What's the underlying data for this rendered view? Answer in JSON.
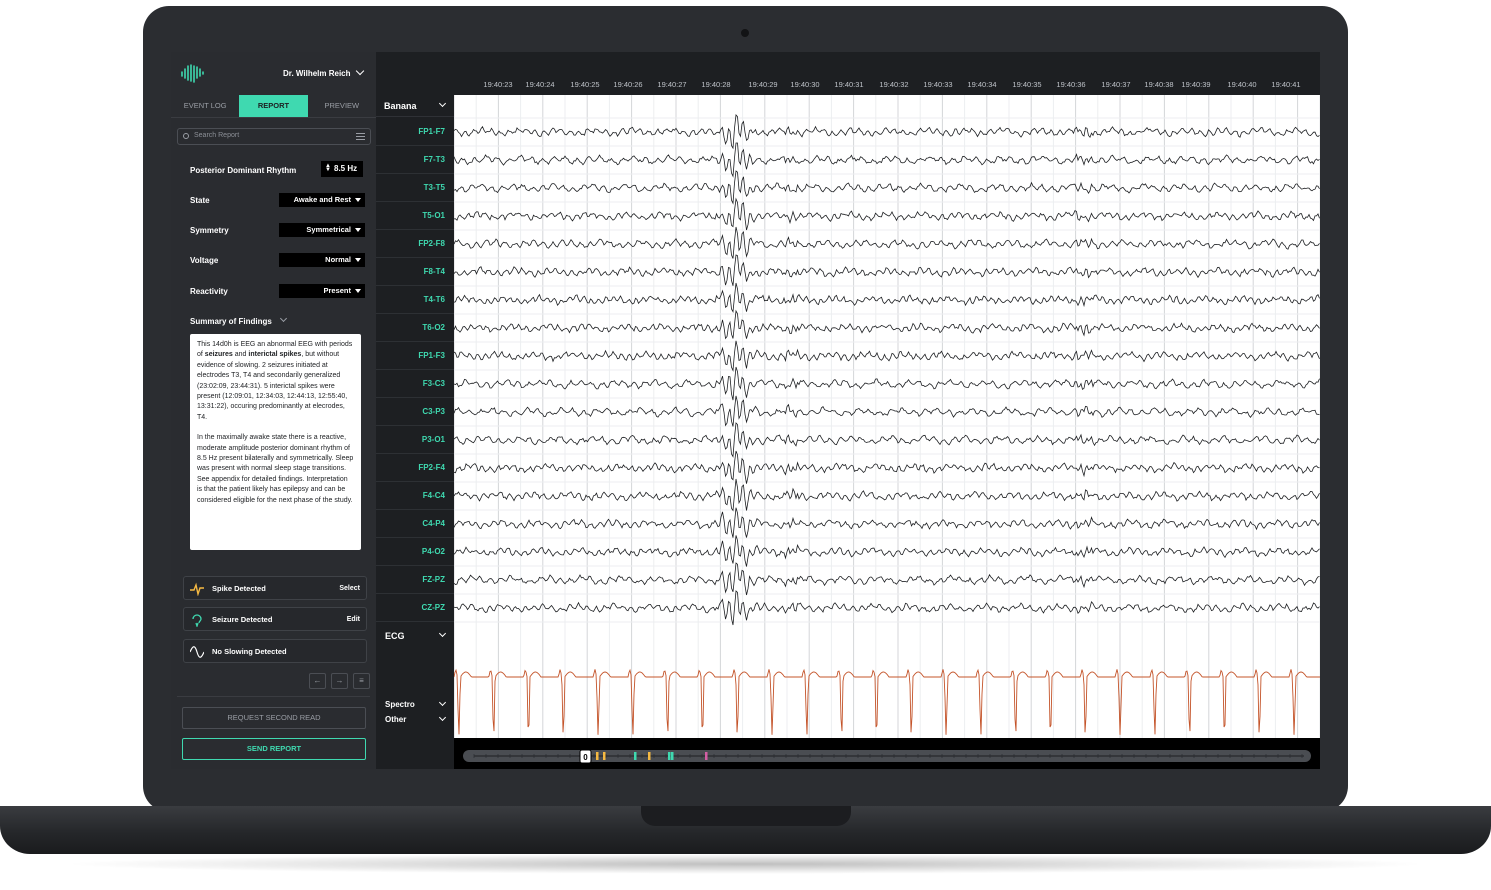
{
  "header": {
    "doctor": "Dr. Wilhelm Reich"
  },
  "tabs": [
    {
      "label": "EVENT LOG",
      "active": false
    },
    {
      "label": "REPORT",
      "active": true
    },
    {
      "label": "PREVIEW",
      "active": false
    }
  ],
  "search": {
    "placeholder": "Search Report"
  },
  "fields": {
    "pdr": {
      "label": "Posterior Dominant Rhythm",
      "value": "8.5 Hz"
    },
    "state": {
      "label": "State",
      "value": "Awake and Rest"
    },
    "symmetry": {
      "label": "Symmetry",
      "value": "Symmetrical"
    },
    "voltage": {
      "label": "Voltage",
      "value": "Normal"
    },
    "reactivity": {
      "label": "Reactivity",
      "value": "Present"
    }
  },
  "summary": {
    "title": "Summary of Findings",
    "p1_a": "This 14d0h is EEG an abnormal EEG with periods of ",
    "p1_b": "seizures",
    "p1_c": " and ",
    "p1_d": "interictal spikes",
    "p1_e": ", but without evidence of slowing. 2 seizures initiated at electrodes T3, T4 and secondarily generalized (23:02:09, 23:44:31). 5 interictal spikes were present (12:09:01, 12:34:03, 12:44:13, 12:55:40, 13:31:22), occuring predominantly at elecrodes, T4.",
    "p2": "In the maximally awake state there is a reactive, moderate amplitude posterior dominant rhythm of 8.5 Hz present bilaterally and symmetrically. Sleep was present with normal sleep stage transitions. See appendix for detailed findings. Interpretation is that the patient likely has epilepsy and can be considered eligible for the next phase of the study."
  },
  "events": [
    {
      "label": "Spike Detected",
      "action": "Select",
      "icon": "spike-icon",
      "color": "#f5b942"
    },
    {
      "label": "Seizure Detected",
      "action": "Edit",
      "icon": "seizure-icon",
      "color": "#3fd9b0"
    },
    {
      "label": "No Slowing Detected",
      "action": "",
      "icon": "slow-wave-icon",
      "color": "#ffffff"
    }
  ],
  "nav": {
    "prev": "←",
    "next": "→"
  },
  "buttons": {
    "second_read": "REQUEST SECOND READ",
    "send": "SEND REPORT"
  },
  "montage": "Banana",
  "channels": [
    "FP1-F7",
    "F7-T3",
    "T3-T5",
    "T5-O1",
    "FP2-F8",
    "F8-T4",
    "T4-T6",
    "T6-O2",
    "FP1-F3",
    "F3-C3",
    "C3-P3",
    "P3-O1",
    "FP2-F4",
    "F4-C4",
    "C4-P4",
    "P4-O2",
    "FZ-PZ",
    "CZ-PZ"
  ],
  "ecg_label": "ECG",
  "spectro_label": "Spectro",
  "other_label": "Other",
  "times": [
    "19:40:23",
    "19:40:24",
    "19:40:25",
    "19:40:26",
    "19:40:27",
    "19:40:28",
    "19:40:29",
    "19:40:30",
    "19:40:31",
    "19:40:32",
    "19:40:33",
    "19:40:34",
    "19:40:35",
    "19:40:36",
    "19:40:37",
    "19:40:38",
    "19:40:39",
    "19:40:40",
    "19:40:41"
  ],
  "scrubber": {
    "current_marker": "0"
  },
  "colors": {
    "accent": "#3fd9b0",
    "ecg": "#c4542a",
    "trace": "#1d1f22"
  }
}
